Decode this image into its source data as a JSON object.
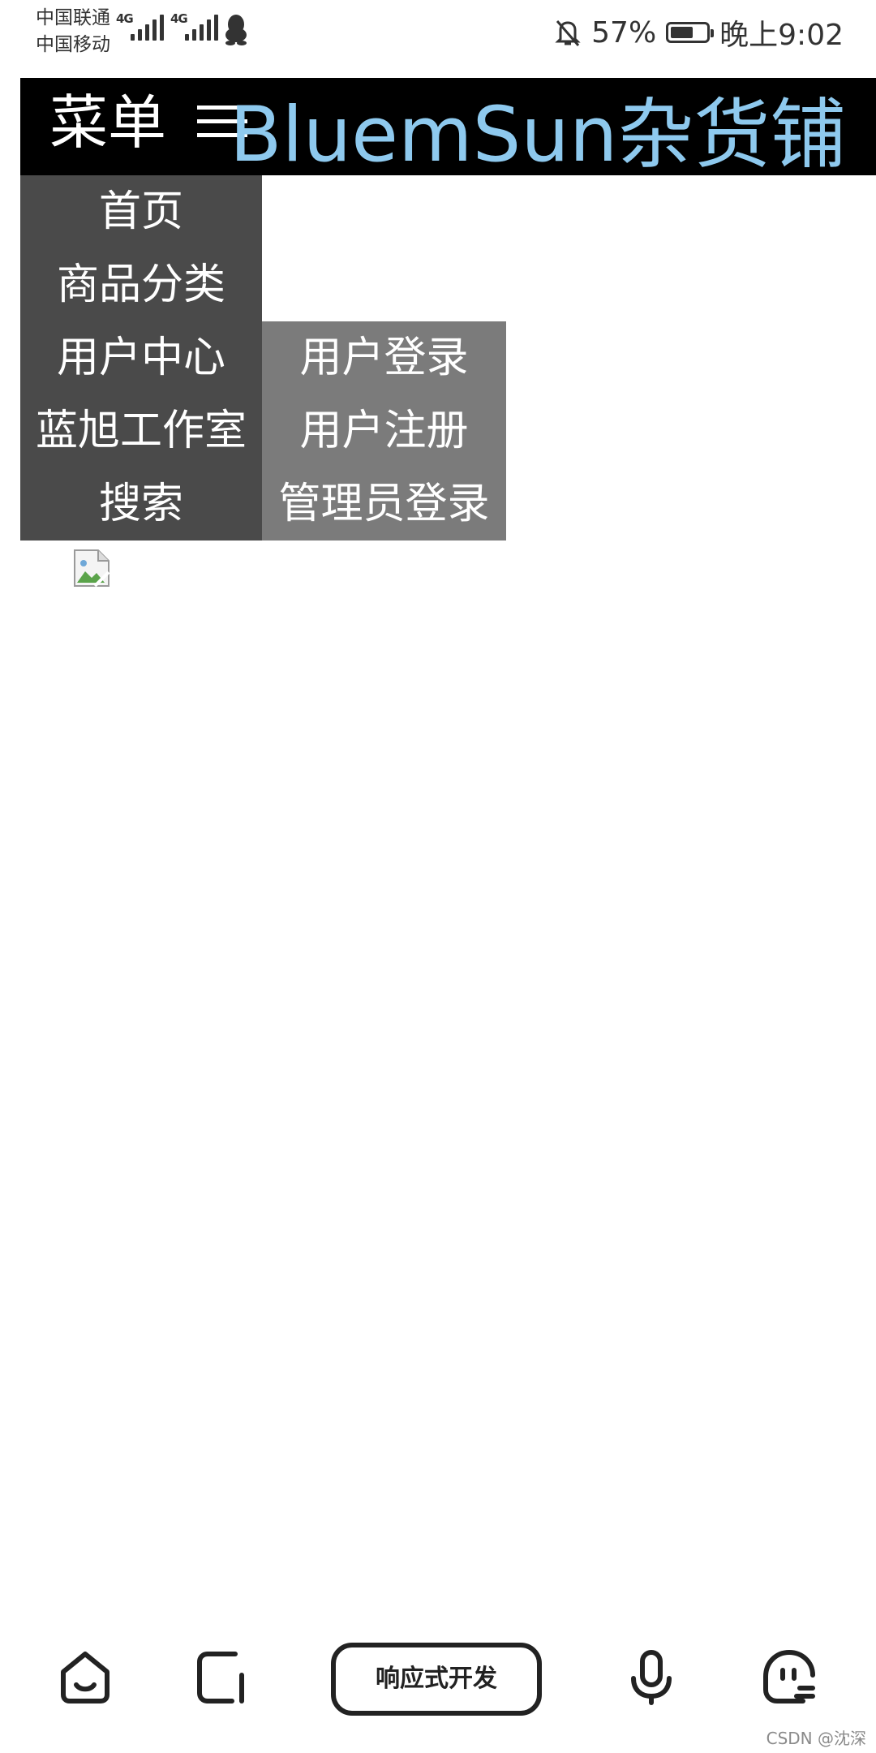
{
  "status_bar": {
    "carrier_1": "中国联通",
    "carrier_2": "中国移动",
    "network_1": "4G",
    "network_2": "4G",
    "battery": "57%",
    "time": "晚上9:02",
    "icons": [
      "signal-icon",
      "signal-icon",
      "qq-icon",
      "mute-bell-icon",
      "battery-icon"
    ]
  },
  "header": {
    "menu_label": "菜单",
    "menu_icon": "hamburger-icon",
    "site_title": "BluemSun杂货铺",
    "title_color": "#8ec9ee",
    "background": "#000000"
  },
  "nav": {
    "background": "#4a4a4a",
    "items": [
      "首页",
      "商品分类",
      "用户中心",
      "蓝旭工作室",
      "搜索"
    ]
  },
  "submenu": {
    "background": "#7b7b7b",
    "items": [
      "用户登录",
      "用户注册",
      "管理员登录"
    ]
  },
  "content": {
    "image_icon": "broken-image-icon"
  },
  "bottom_bar": {
    "pill_label": "响应式开发",
    "icons": [
      "home-face-icon",
      "tabs-icon",
      "microphone-icon",
      "assistant-face-icon"
    ]
  },
  "watermark": "CSDN @沈深"
}
